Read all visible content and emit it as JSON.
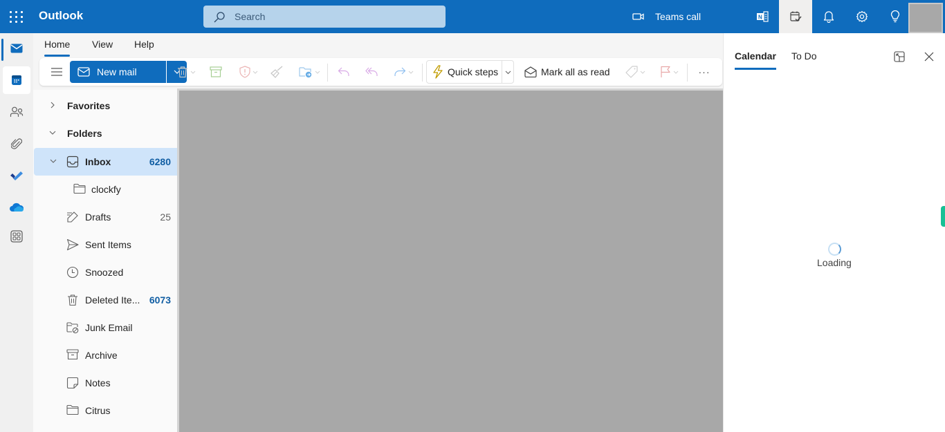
{
  "app": {
    "title": "Outlook"
  },
  "search": {
    "placeholder": "Search"
  },
  "header": {
    "teams_call_label": "Teams call",
    "icons": [
      "onenote-feed-icon",
      "my-day-icon",
      "bell-icon",
      "gear-icon",
      "lightbulb-icon"
    ]
  },
  "rail": {
    "items": [
      {
        "name": "mail",
        "selected": false,
        "indicator": true
      },
      {
        "name": "calendar",
        "selected": true
      },
      {
        "name": "people"
      },
      {
        "name": "files"
      },
      {
        "name": "to-do"
      },
      {
        "name": "onedrive"
      },
      {
        "name": "more-apps"
      }
    ]
  },
  "ribbon": {
    "tabs": [
      {
        "label": "Home",
        "selected": true
      },
      {
        "label": "View"
      },
      {
        "label": "Help"
      }
    ],
    "new_mail_label": "New mail",
    "quick_steps_label": "Quick steps",
    "mark_all_read_label": "Mark all as read",
    "more_label": "···",
    "icons": [
      "delete-icon",
      "archive-icon",
      "report-icon",
      "sweep-icon",
      "move-to-icon",
      "reply-icon",
      "reply-all-icon",
      "forward-icon",
      "tag-icon",
      "flag-icon"
    ]
  },
  "folders": {
    "favorites_label": "Favorites",
    "folders_label": "Folders",
    "items": [
      {
        "name": "Inbox",
        "count": "6280",
        "unread": true,
        "selected": true,
        "expandable": true
      },
      {
        "name": "clockfy",
        "count": "",
        "child": true
      },
      {
        "name": "Drafts",
        "count": "25",
        "unread": false
      },
      {
        "name": "Sent Items",
        "count": ""
      },
      {
        "name": "Snoozed",
        "count": ""
      },
      {
        "name": "Deleted Ite...",
        "count": "6073",
        "unread": true
      },
      {
        "name": "Junk Email",
        "count": ""
      },
      {
        "name": "Archive",
        "count": ""
      },
      {
        "name": "Notes",
        "count": ""
      },
      {
        "name": "Citrus",
        "count": ""
      }
    ]
  },
  "side_pane": {
    "tabs": [
      {
        "label": "Calendar",
        "selected": true
      },
      {
        "label": "To Do"
      }
    ],
    "loading_label": "Loading"
  },
  "colors": {
    "brand": "#0f6cbd",
    "selected_row": "#cfe4fa",
    "unread_count": "#115ea3",
    "reading_pane": "#a8a8a8"
  }
}
